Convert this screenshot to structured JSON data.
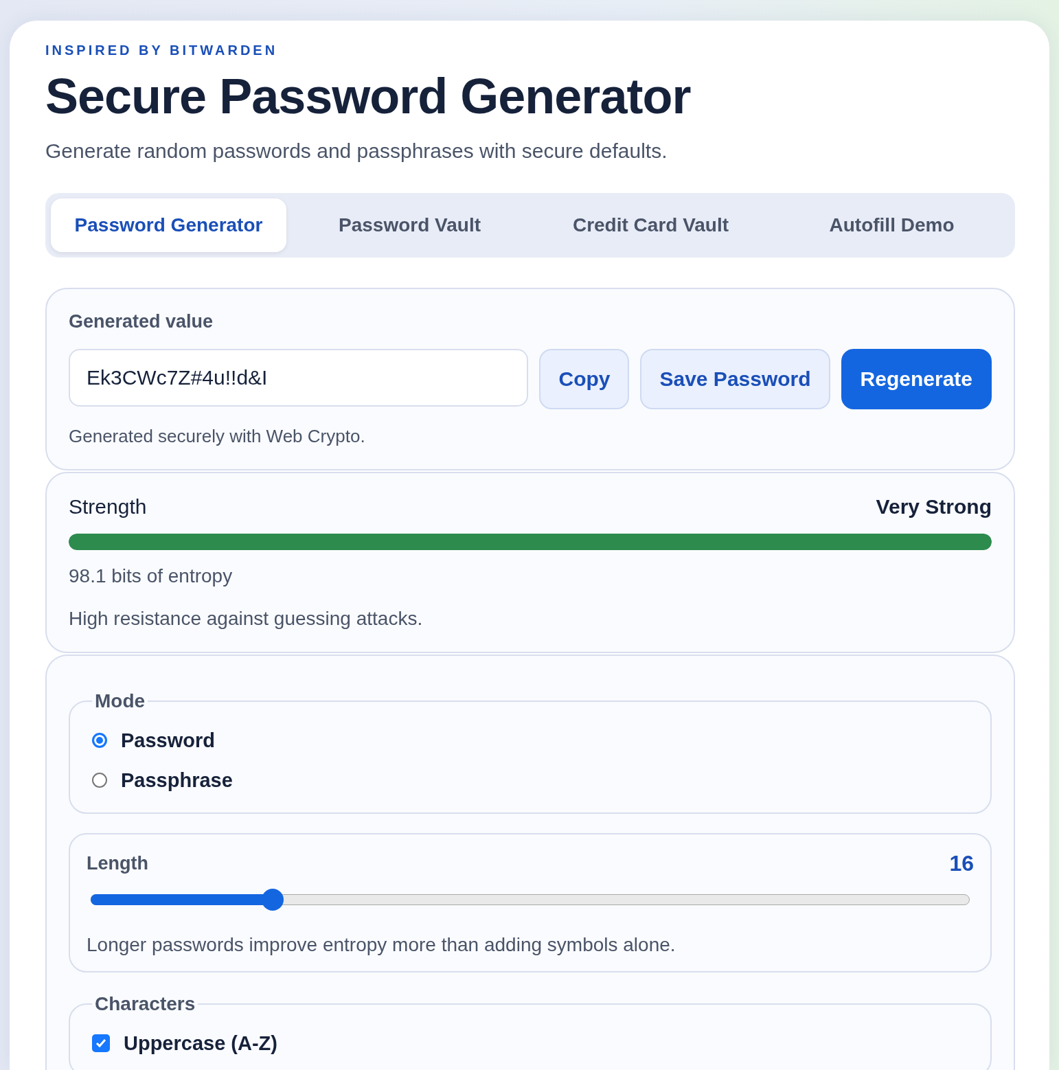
{
  "eyebrow": "INSPIRED BY BITWARDEN",
  "title": "Secure Password Generator",
  "subtitle": "Generate random passwords and passphrases with secure defaults.",
  "tabs": [
    {
      "label": "Password Generator",
      "selected": true
    },
    {
      "label": "Password Vault",
      "selected": false
    },
    {
      "label": "Credit Card Vault",
      "selected": false
    },
    {
      "label": "Autofill Demo",
      "selected": false
    }
  ],
  "generated": {
    "label": "Generated value",
    "value": "Ek3CWc7Z#4u!!d&I",
    "buttons": [
      {
        "label": "Copy",
        "kind": "secondary"
      },
      {
        "label": "Save Password",
        "kind": "secondary"
      },
      {
        "label": "Regenerate",
        "kind": "primary"
      }
    ],
    "note": "Generated securely with Web Crypto."
  },
  "strength": {
    "label": "Strength",
    "rating": "Very Strong",
    "level": 1,
    "color": "#2e8b4e",
    "entropy": "98.1 bits of entropy",
    "description": "High resistance against guessing attacks."
  },
  "mode": {
    "legend": "Mode",
    "options": [
      {
        "label": "Password",
        "selected": true
      },
      {
        "label": "Passphrase",
        "selected": false
      }
    ]
  },
  "length": {
    "label": "Length",
    "value": "16",
    "level": 0.207,
    "hint": "Longer passwords improve entropy more than adding symbols alone."
  },
  "characters": {
    "legend": "Characters",
    "options": [
      {
        "label": "Uppercase (A-Z)",
        "checked": true
      }
    ]
  }
}
